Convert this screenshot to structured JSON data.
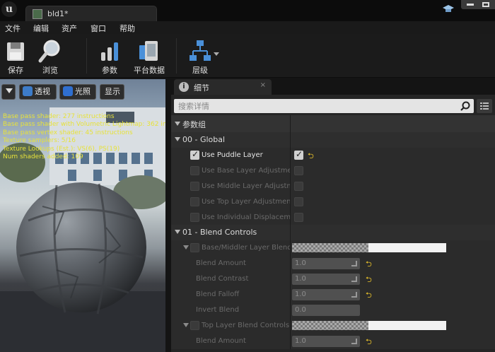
{
  "window": {
    "tab_title": "bld1*"
  },
  "menu": [
    "文件",
    "编辑",
    "资产",
    "窗口",
    "帮助"
  ],
  "toolbar": {
    "save": "保存",
    "browse": "浏览",
    "params": "参数",
    "platform": "平台数据",
    "hierarchy": "层级"
  },
  "viewport": {
    "buttons": {
      "perspective": "透视",
      "lighting": "光照",
      "show": "显示"
    },
    "stats": [
      "Base pass shader: 277 instructions",
      "Base pass shader with Volumetric Lightmap: 362 ins",
      "Base pass vertex shader: 45 instructions",
      "Texture samplers: 5/16",
      "Texture Lookups (Est.): VS(6), PS(19)",
      "Num shaders added: 109"
    ]
  },
  "details": {
    "tab_label": "细节",
    "search_placeholder": "搜索详情",
    "group_header": "参数组",
    "global": {
      "label": "00 - Global",
      "params": [
        "Use Puddle Layer",
        "Use Base Layer Adjustments",
        "Use Middle Layer Adjustmen",
        "Use Top Layer Adjustments",
        "Use Individual Displacement"
      ]
    },
    "blend": {
      "label": "01 - Blend Controls",
      "base_middle": "Base/Middler Layer Blend C",
      "top_layer": "Top Layer Blend Controls",
      "amount": "Blend Amount",
      "contrast": "Blend Contrast",
      "falloff": "Blend Falloff",
      "invert": "Invert Blend",
      "values": {
        "amount": "1.0",
        "contrast": "1.0",
        "falloff": "1.0",
        "invert": "0.0",
        "top_amount": "1.0"
      }
    }
  },
  "colors": {
    "stat_text": "#e7e23a",
    "reset_arrow": "#e8c12a",
    "panel_bg": "#252525"
  }
}
